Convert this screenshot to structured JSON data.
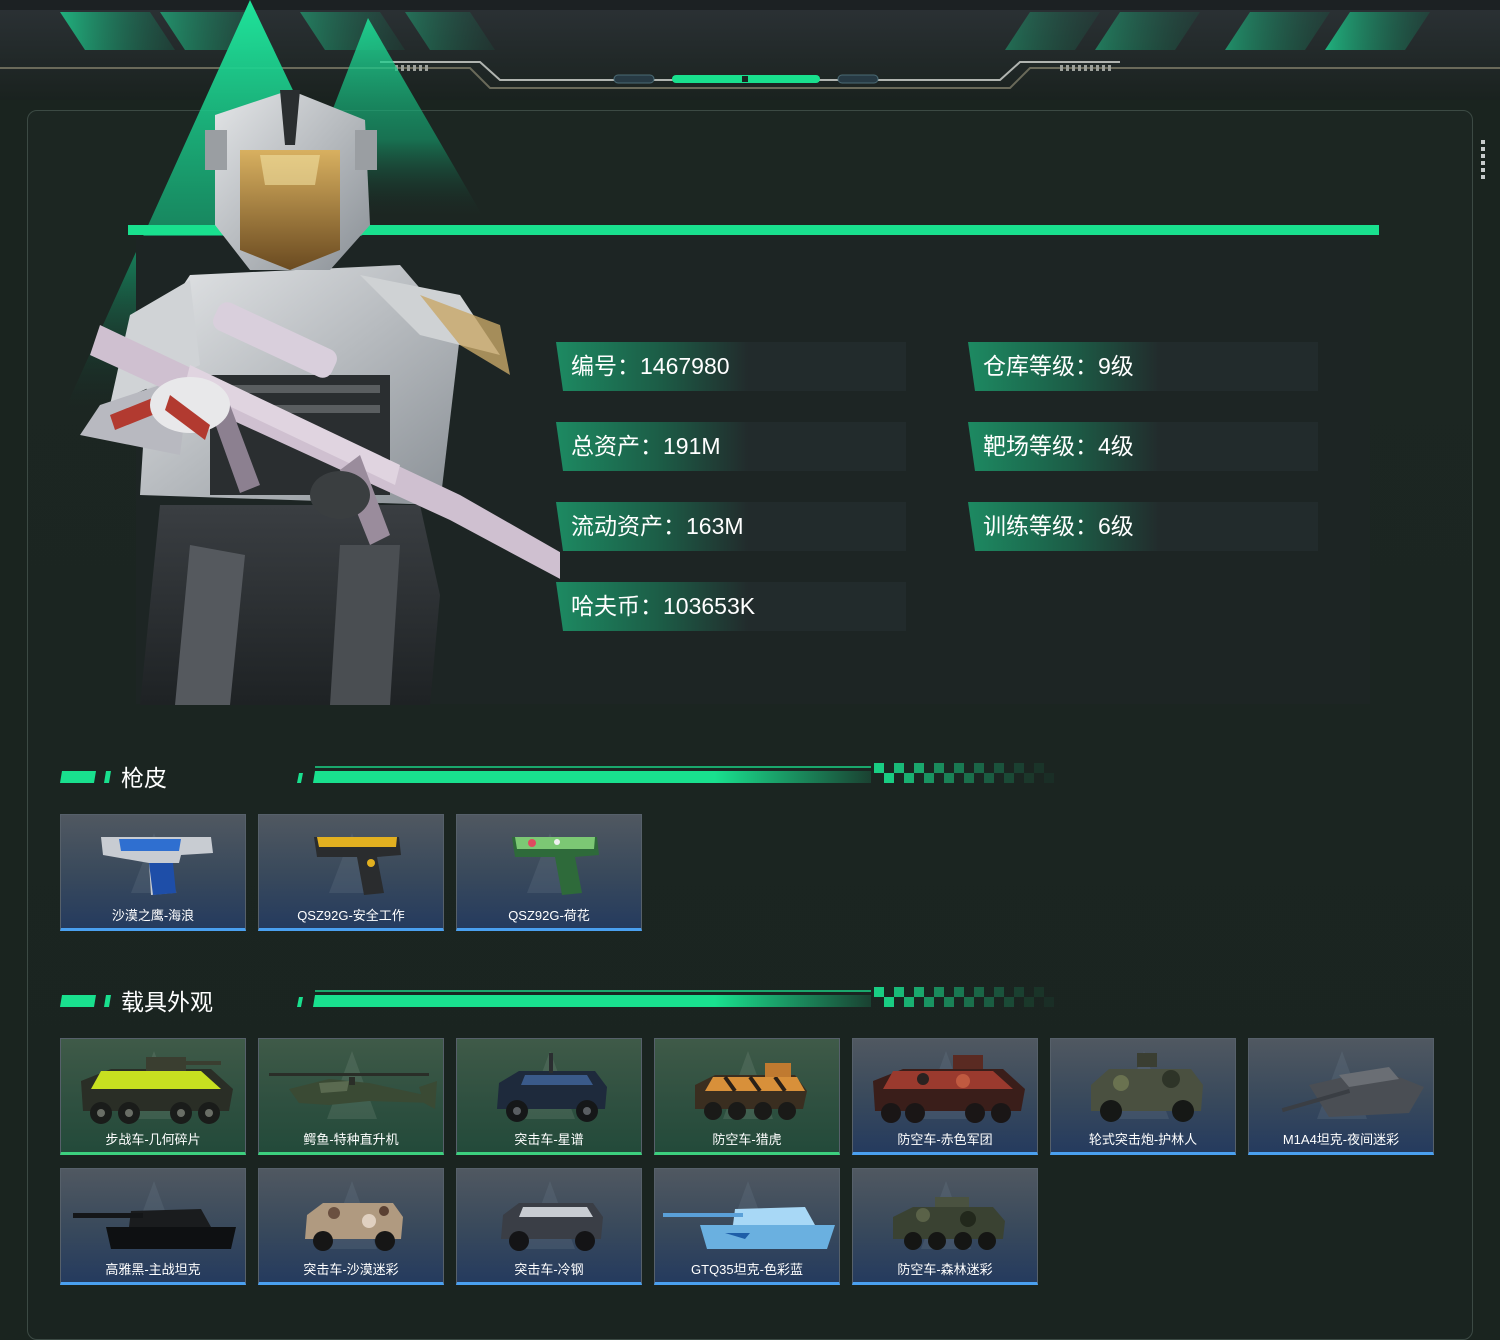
{
  "colors": {
    "accent": "#19e08e",
    "background": "#1a241f",
    "rarity_blue": "#4aa0f0",
    "rarity_green": "#3cd07e"
  },
  "stats": [
    {
      "label": "编号：",
      "value": "1467980"
    },
    {
      "label": "仓库等级：",
      "value": "9级"
    },
    {
      "label": "总资产：",
      "value": "191M"
    },
    {
      "label": "靶场等级：",
      "value": "4级"
    },
    {
      "label": "流动资产：",
      "value": "163M"
    },
    {
      "label": "训练等级：",
      "value": "6级"
    },
    {
      "label": "哈夫币：",
      "value": "103653K"
    }
  ],
  "sections": {
    "gun_skins": {
      "title": "枪皮",
      "items": [
        {
          "name": "沙漠之鹰-海浪",
          "rarity": "blue",
          "icon": "pistol-icon"
        },
        {
          "name": "QSZ92G-安全工作",
          "rarity": "blue",
          "icon": "pistol-icon"
        },
        {
          "name": "QSZ92G-荷花",
          "rarity": "blue",
          "icon": "pistol-icon"
        }
      ]
    },
    "vehicle_skins": {
      "title": "载具外观",
      "items": [
        {
          "name": "步战车-几何碎片",
          "rarity": "green",
          "icon": "armored-car-icon"
        },
        {
          "name": "鳄鱼-特种直升机",
          "rarity": "green",
          "icon": "helicopter-icon"
        },
        {
          "name": "突击车-星谱",
          "rarity": "green",
          "icon": "assault-vehicle-icon"
        },
        {
          "name": "防空车-猎虎",
          "rarity": "green",
          "icon": "armored-car-icon"
        },
        {
          "name": "防空车-赤色军团",
          "rarity": "blue",
          "icon": "armored-car-icon"
        },
        {
          "name": "轮式突击炮-护林人",
          "rarity": "blue",
          "icon": "assault-vehicle-icon"
        },
        {
          "name": "M1A4坦克-夜间迷彩",
          "rarity": "blue",
          "icon": "tank-icon"
        },
        {
          "name": "高雅黑-主战坦克",
          "rarity": "blue",
          "icon": "tank-icon"
        },
        {
          "name": "突击车-沙漠迷彩",
          "rarity": "blue",
          "icon": "assault-vehicle-icon"
        },
        {
          "name": "突击车-冷钢",
          "rarity": "blue",
          "icon": "assault-vehicle-icon"
        },
        {
          "name": "GTQ35坦克-色彩蓝",
          "rarity": "blue",
          "icon": "tank-icon"
        },
        {
          "name": "防空车-森林迷彩",
          "rarity": "blue",
          "icon": "armored-car-icon"
        }
      ]
    }
  }
}
